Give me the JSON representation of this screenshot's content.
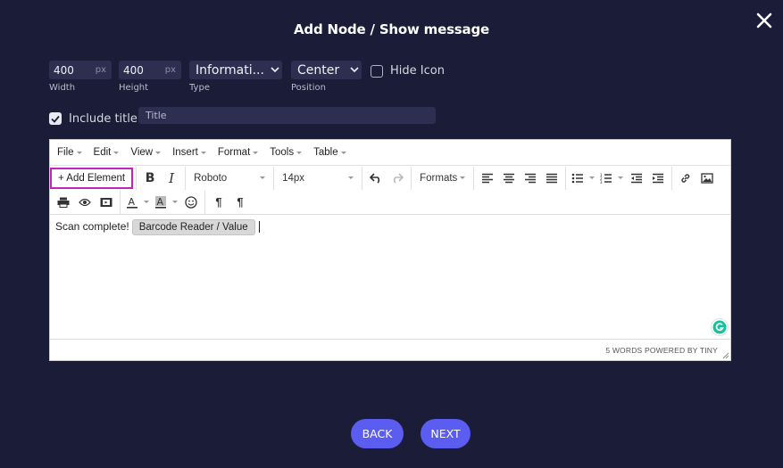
{
  "dialog": {
    "title": "Add Node / Show message"
  },
  "form": {
    "width": {
      "value": "400",
      "unit": "px",
      "label": "Width"
    },
    "height": {
      "value": "400",
      "unit": "px",
      "label": "Height"
    },
    "type": {
      "value": "Informati...",
      "label": "Type"
    },
    "position": {
      "value": "Center",
      "label": "Position"
    },
    "hide_icon": {
      "label": "Hide Icon",
      "checked": false
    },
    "include_title": {
      "label": "Include title",
      "checked": true
    },
    "title_input": {
      "placeholder": "Title",
      "value": ""
    }
  },
  "editor": {
    "menus": [
      "File",
      "Edit",
      "View",
      "Insert",
      "Format",
      "Tools",
      "Table"
    ],
    "toolbar": {
      "add_element": "+ Add Element",
      "font": "Roboto",
      "size": "14px",
      "formats": "Formats"
    },
    "content": {
      "text": "Scan complete!",
      "chip": "Barcode Reader / Value"
    },
    "status": "5 WORDS POWERED BY TINY"
  },
  "footer": {
    "back_label": "BACK",
    "next_label": "NEXT"
  },
  "colors": {
    "background": "#1a1c38",
    "accent": "#5b5cf0",
    "highlight": "#c026b8"
  }
}
